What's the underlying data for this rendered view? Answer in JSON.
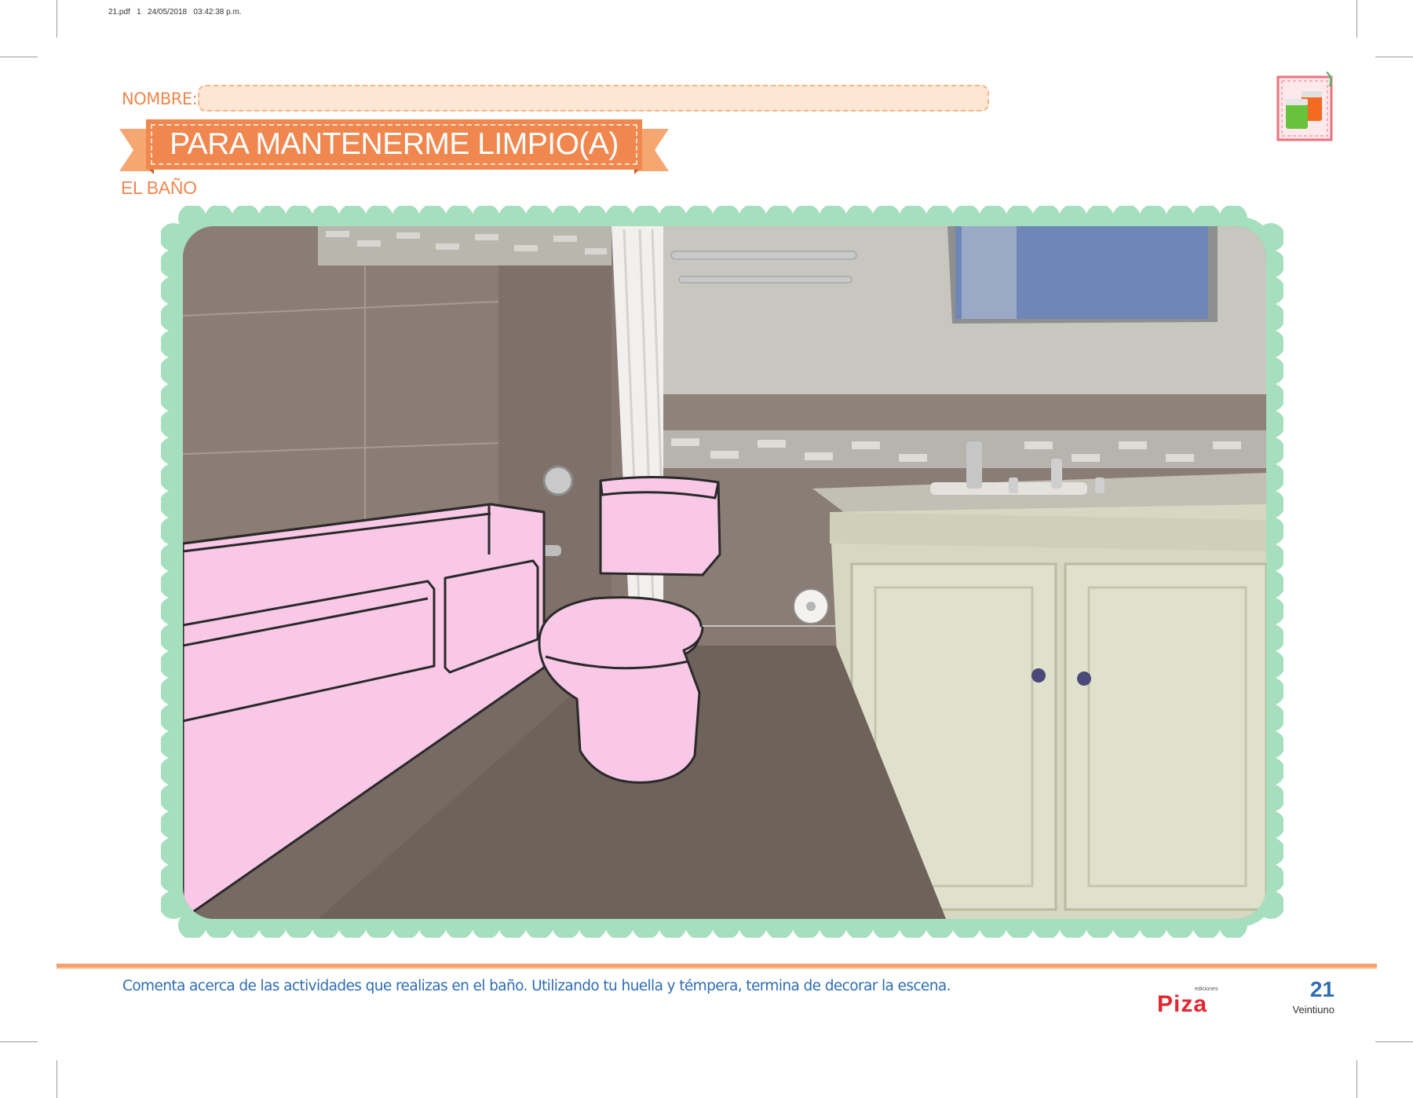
{
  "print_info": "21.pdf   1   24/05/2018   03:42:38 p.m.",
  "header": {
    "name_label": "NOMBRE:",
    "title": "PARA MANTENERME LIMPIO(A)",
    "subtitle": "EL BAÑO"
  },
  "footer": {
    "instructions": "Comenta acerca de las actividades que realizas en el baño. Utilizando tu huella y témpera, termina de decorar la escena.",
    "logo_small": "ediciones",
    "logo_text": "Piza",
    "page_number": "21",
    "page_word": "Veintiuno"
  },
  "colors": {
    "accent": "#f0874f",
    "frame": "#a5dfbd",
    "highlight_fill": "#f8c8e6",
    "text_blue": "#2f6db3",
    "logo_red": "#e3262f"
  },
  "scene": {
    "highlighted_objects": [
      "bathtub-icon",
      "toilet-icon"
    ],
    "other_objects": [
      "shower-curtain",
      "towel-bar",
      "mirror",
      "vanity-cabinet",
      "sink-faucet",
      "toilet-paper-roll"
    ]
  }
}
